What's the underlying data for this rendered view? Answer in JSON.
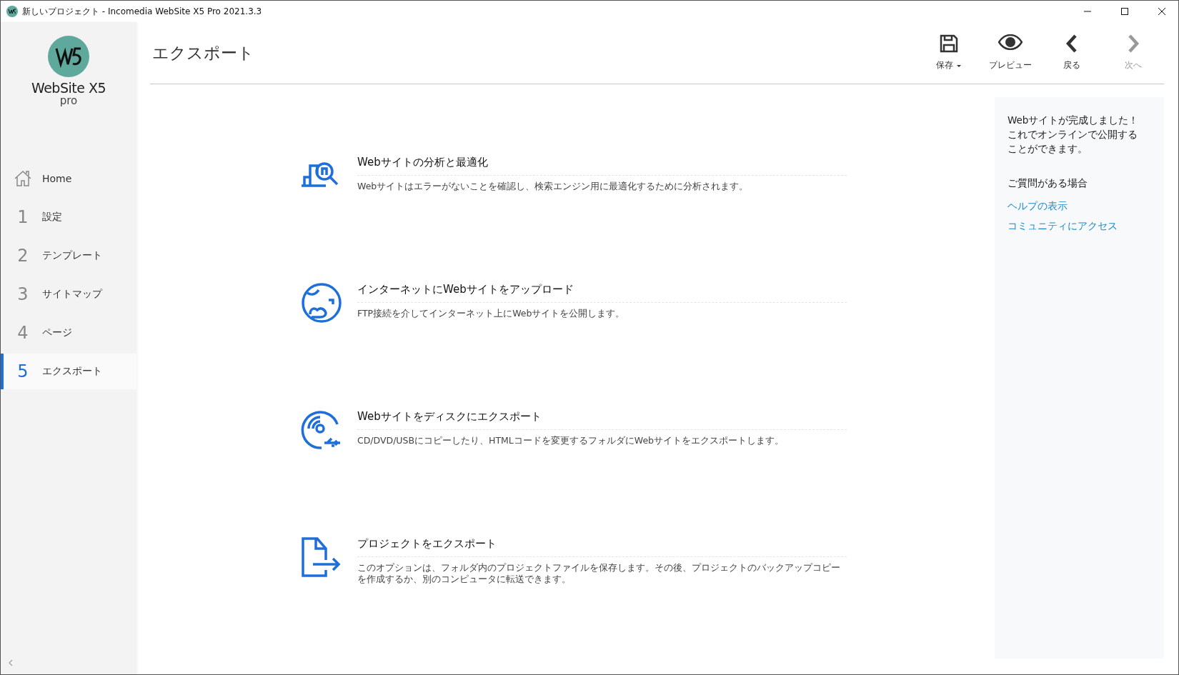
{
  "window": {
    "title": "新しいプロジェクト - Incomedia WebSite X5 Pro 2021.3.3"
  },
  "logo": {
    "name": "WebSite X5",
    "edition": "pro"
  },
  "sidebar": {
    "items": [
      {
        "kind": "home",
        "label": "Home",
        "selected": false
      },
      {
        "kind": "step",
        "number": "1",
        "label": "設定",
        "selected": false
      },
      {
        "kind": "step",
        "number": "2",
        "label": "テンプレート",
        "selected": false
      },
      {
        "kind": "step",
        "number": "3",
        "label": "サイトマップ",
        "selected": false
      },
      {
        "kind": "step",
        "number": "4",
        "label": "ページ",
        "selected": false
      },
      {
        "kind": "step",
        "number": "5",
        "label": "エクスポート",
        "selected": true
      }
    ]
  },
  "page": {
    "title": "エクスポート"
  },
  "toolbar": [
    {
      "kind": "save",
      "label": "保存",
      "dropdown": true,
      "disabled": false
    },
    {
      "kind": "preview",
      "label": "プレビュー",
      "dropdown": false,
      "disabled": false
    },
    {
      "kind": "back",
      "label": "戻る",
      "dropdown": false,
      "disabled": false
    },
    {
      "kind": "next",
      "label": "次へ",
      "dropdown": false,
      "disabled": true
    }
  ],
  "options": [
    {
      "kind": "analyze",
      "title": "Webサイトの分析と最適化",
      "description": "Webサイトはエラーがないことを確認し、検索エンジン用に最適化するために分析されます。"
    },
    {
      "kind": "upload",
      "title": "インターネットにWebサイトをアップロード",
      "description": "FTP接続を介してインターネット上にWebサイトを公開します。"
    },
    {
      "kind": "disk",
      "title": "Webサイトをディスクにエクスポート",
      "description": "CD/DVD/USBにコピーしたり、HTMLコードを変更するフォルダにWebサイトをエクスポートします。"
    },
    {
      "kind": "project",
      "title": "プロジェクトをエクスポート",
      "description": "このオプションは、フォルダ内のプロジェクトファイルを保存します。その後、プロジェクトのバックアップコピーを作成するか、別のコンピュータに転送できます。"
    }
  ],
  "info_panel": {
    "message": "Webサイトが完成しました！これでオンラインで公開することができます。",
    "help_heading": "ご質問がある場合",
    "links": [
      "ヘルプの表示",
      "コミュニティにアクセス"
    ]
  }
}
